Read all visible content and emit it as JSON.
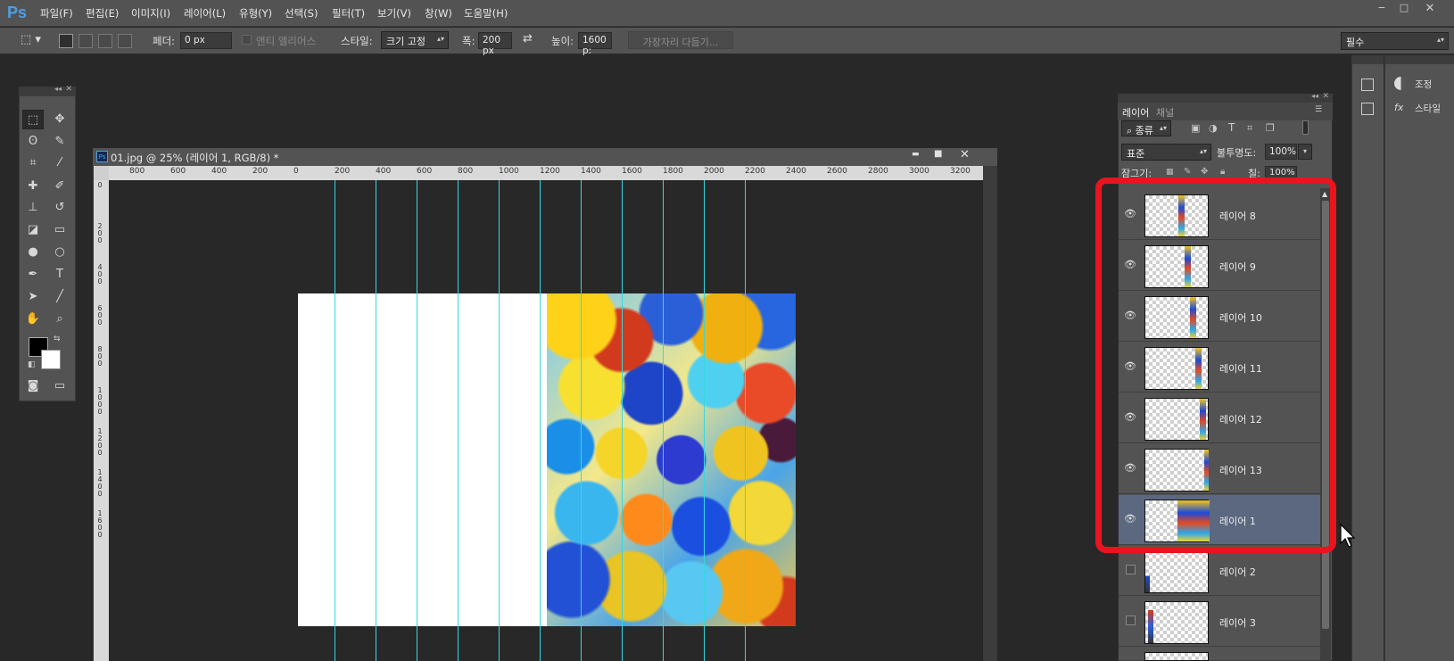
{
  "app": {
    "logo": "Ps",
    "menu": [
      "파일(F)",
      "편집(E)",
      "이미지(I)",
      "레이어(L)",
      "유형(Y)",
      "선택(S)",
      "필터(T)",
      "보기(V)",
      "창(W)",
      "도움말(H)"
    ],
    "window_controls": {
      "minimize": "−",
      "maximize": "□",
      "close": "✕"
    }
  },
  "options_bar": {
    "feather_label": "페더:",
    "feather_value": "0 px",
    "antialias_label": "앤티 앨리어스",
    "style_label": "스타일:",
    "style_value": "크기 고정",
    "width_label": "폭:",
    "width_value": "200 px",
    "height_label": "높이:",
    "height_value": "1600 p:",
    "refine_edge_label": "가장자리 다듬기...",
    "workspace_value": "필수"
  },
  "document": {
    "title": "01.jpg @ 25% (레이어 1, RGB/8) *",
    "ruler_h_ticks": [
      "800",
      "600",
      "400",
      "200",
      "0",
      "200",
      "400",
      "600",
      "800",
      "1000",
      "1200",
      "1400",
      "1600",
      "1800",
      "2000",
      "2200",
      "2400",
      "2600",
      "2800",
      "3000",
      "3200"
    ],
    "ruler_v_ticks": [
      "0",
      "2 0 0",
      "4 0 0",
      "6 0 0",
      "8 0 0",
      "1 0 0 0",
      "1 2 0 0",
      "1 4 0 0",
      "1 6 0 0"
    ],
    "controls": {
      "minimize": "▬",
      "maximize": "■",
      "close": "✕"
    }
  },
  "right_panel": {
    "adjust_label": "조정",
    "style_label": "스타일"
  },
  "layers_panel": {
    "tabs": [
      "레이어",
      "채널"
    ],
    "filter_value": "종류",
    "blend_mode": "표준",
    "opacity_label": "불투명도:",
    "opacity_value": "100%",
    "lock_label": "잠그기:",
    "fill_label": "칠:",
    "fill_value": "100%",
    "layers": [
      {
        "name": "레이어 8",
        "visible": true,
        "selected": false
      },
      {
        "name": "레이어 9",
        "visible": true,
        "selected": false
      },
      {
        "name": "레이어 10",
        "visible": true,
        "selected": false
      },
      {
        "name": "레이어 11",
        "visible": true,
        "selected": false
      },
      {
        "name": "레이어 12",
        "visible": true,
        "selected": false
      },
      {
        "name": "레이어 13",
        "visible": true,
        "selected": false
      },
      {
        "name": "레이어 1",
        "visible": true,
        "selected": true
      },
      {
        "name": "레이어 2",
        "visible": false,
        "selected": false
      },
      {
        "name": "레이어 3",
        "visible": false,
        "selected": false
      }
    ]
  },
  "colors": {
    "highlight": "#e8141e",
    "guide": "#36d8e0",
    "selected_layer": "#5b6880"
  }
}
